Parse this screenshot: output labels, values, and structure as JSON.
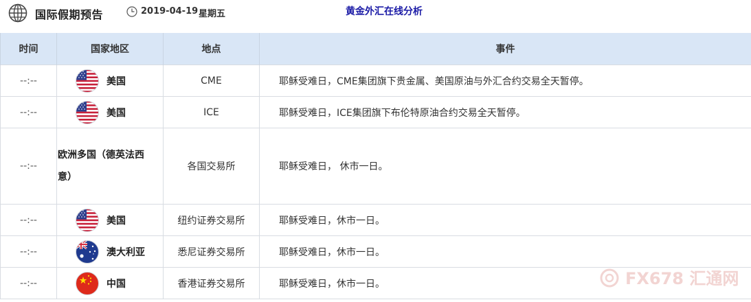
{
  "header": {
    "title": "国际假期预告",
    "date": "2019-04-19",
    "weekday": "星期五",
    "analysis_link": "黄金外汇在线分析"
  },
  "table": {
    "columns": [
      "时间",
      "国家地区",
      "地点",
      "事件"
    ],
    "rows": [
      {
        "time": "--:--",
        "country": "美国",
        "flag": "us-flag-icon",
        "location": "CME",
        "event": "耶稣受难日，CME集团旗下贵金属、美国原油与外汇合约交易全天暂停。"
      },
      {
        "time": "--:--",
        "country": "美国",
        "flag": "us-flag-icon",
        "location": "ICE",
        "event": "耶稣受难日，ICE集团旗下布伦特原油合约交易全天暂停。"
      },
      {
        "time": "--:--",
        "country_line1": "欧洲多国（德英法西",
        "country_line2": "意）",
        "location": "各国交易所",
        "event": "耶稣受难日， 休市一日。"
      },
      {
        "time": "--:--",
        "country": "美国",
        "flag": "us-flag-icon",
        "location": "纽约证券交易所",
        "event": "耶稣受难日，休市一日。"
      },
      {
        "time": "--:--",
        "country": "澳大利亚",
        "flag": "australia-flag-icon",
        "location": "悉尼证券交易所",
        "event": "耶稣受难日，休市一日。"
      },
      {
        "time": "--:--",
        "country": "中国",
        "flag": "china-flag-icon",
        "location": "香港证券交易所",
        "event": "耶稣受难日，休市一日。"
      }
    ]
  },
  "watermark": {
    "text": "FX678 汇通网"
  },
  "colors": {
    "header_bg": "#d9e6f6",
    "link": "#1a1aa6",
    "border": "#d8dce2"
  }
}
